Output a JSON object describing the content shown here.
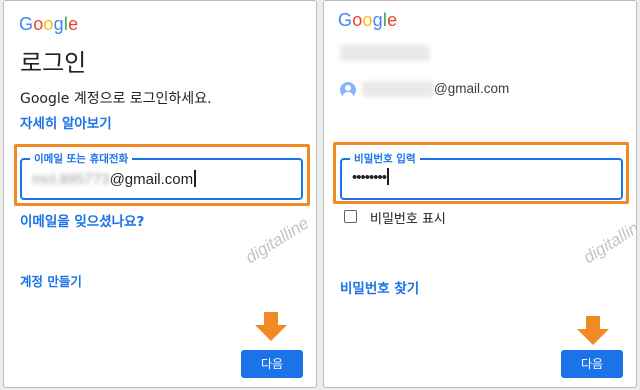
{
  "brand": {
    "letters": [
      "G",
      "o",
      "o",
      "g",
      "l",
      "e"
    ],
    "colors": [
      "#4285f4",
      "#ea4335",
      "#fbbc05",
      "#4285f4",
      "#34a853",
      "#ea4335"
    ]
  },
  "accent_color": "#1a73e8",
  "highlight_color": "#f08a24",
  "watermark": "digitalline",
  "left_panel": {
    "title": "로그인",
    "subtitle": "Google 계정으로 로그인하세요.",
    "learn_more": "자세히 알아보기",
    "email_field": {
      "label": "이메일 또는 휴대전화",
      "value_hidden": "mcl.895773",
      "value_visible": "@gmail.com"
    },
    "forgot_email": "이메일을 잊으셨나요?",
    "create_account": "계정 만들기",
    "next_button": "다음"
  },
  "right_panel": {
    "account_email_suffix": "@gmail.com",
    "password_field": {
      "label": "비밀번호 입력",
      "value": "••••••••"
    },
    "show_password": "비밀번호 표시",
    "show_password_checked": false,
    "forgot_password": "비밀번호 찾기",
    "next_button": "다음"
  }
}
